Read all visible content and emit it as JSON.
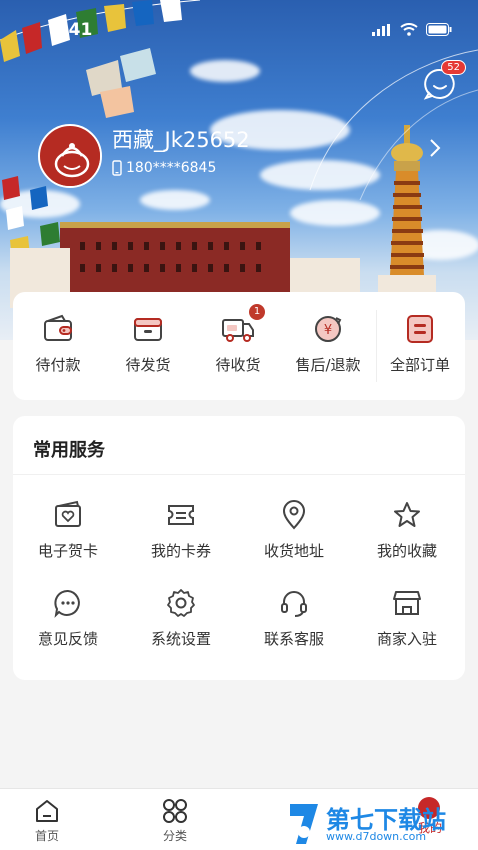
{
  "status_bar": {
    "time": "9:41"
  },
  "profile": {
    "username": "西藏_Jk25652",
    "phone": "180****6845",
    "message_badge": "52"
  },
  "orders": {
    "items": [
      {
        "label": "待付款",
        "icon": "wallet-icon"
      },
      {
        "label": "待发货",
        "icon": "box-icon"
      },
      {
        "label": "待收货",
        "icon": "truck-icon",
        "badge": "1"
      },
      {
        "label": "售后/退款",
        "icon": "refund-icon"
      },
      {
        "label": "全部订单",
        "icon": "order-list-icon"
      }
    ]
  },
  "services": {
    "title": "常用服务",
    "items": [
      {
        "label": "电子贺卡",
        "icon": "greeting-card-icon"
      },
      {
        "label": "我的卡券",
        "icon": "coupon-icon"
      },
      {
        "label": "收货地址",
        "icon": "location-icon"
      },
      {
        "label": "我的收藏",
        "icon": "star-icon"
      },
      {
        "label": "意见反馈",
        "icon": "feedback-icon"
      },
      {
        "label": "系统设置",
        "icon": "gear-icon"
      },
      {
        "label": "联系客服",
        "icon": "headset-icon"
      },
      {
        "label": "商家入驻",
        "icon": "store-icon"
      }
    ]
  },
  "tabbar": {
    "items": [
      {
        "label": "首页",
        "icon": "home-icon"
      },
      {
        "label": "分类",
        "icon": "category-icon"
      },
      {
        "label": "我的",
        "icon": "user-icon"
      }
    ]
  },
  "watermark": {
    "text": "第七下载站",
    "url": "www.d7down.com"
  },
  "colors": {
    "accent": "#b52b22",
    "sky": "#3f7fd0",
    "background": "#f4f4f4"
  }
}
